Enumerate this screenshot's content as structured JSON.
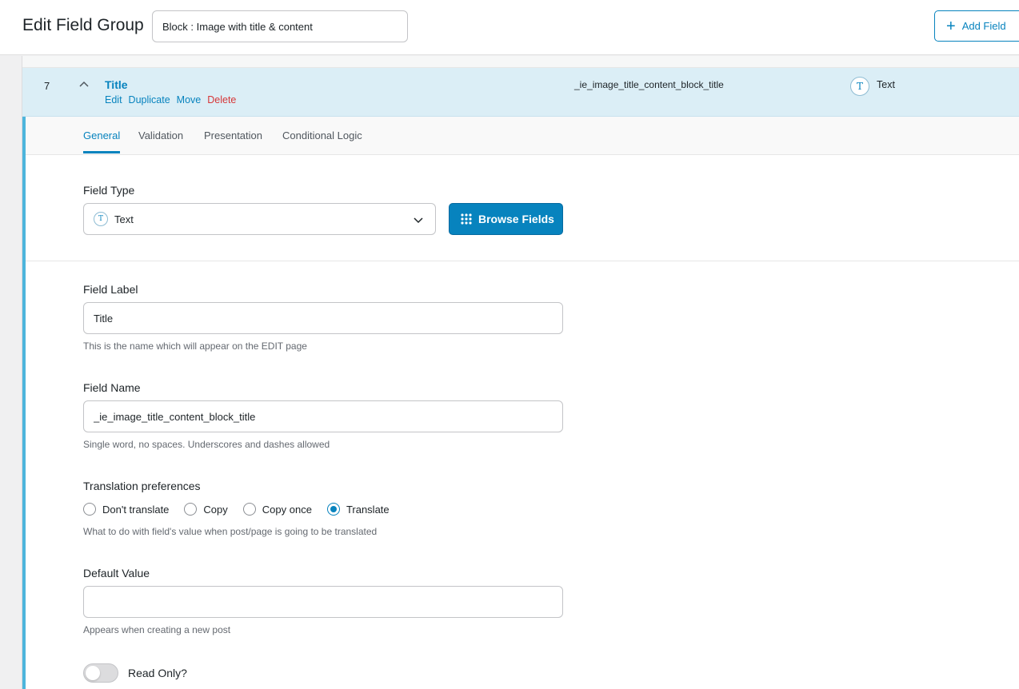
{
  "header": {
    "title": "Edit Field Group",
    "group_title_value": "Block : Image with title & content",
    "add_field_label": "Add Field"
  },
  "field": {
    "order": "7",
    "label": "Title",
    "actions": {
      "edit": "Edit",
      "duplicate": "Duplicate",
      "move": "Move",
      "delete": "Delete"
    },
    "key": "_ie_image_title_content_block_title",
    "type_badge": "T",
    "type": "Text"
  },
  "tabs": [
    "General",
    "Validation",
    "Presentation",
    "Conditional Logic"
  ],
  "active_tab": "General",
  "general": {
    "field_type_label": "Field Type",
    "field_type_icon": "T",
    "field_type_value": "Text",
    "browse_fields_label": "Browse Fields",
    "field_label_label": "Field Label",
    "field_label_value": "Title",
    "field_label_hint": "This is the name which will appear on the EDIT page",
    "field_name_label": "Field Name",
    "field_name_value": "_ie_image_title_content_block_title",
    "field_name_hint": "Single word, no spaces. Underscores and dashes allowed",
    "translation_label": "Translation preferences",
    "translation_options": [
      "Don't translate",
      "Copy",
      "Copy once",
      "Translate"
    ],
    "translation_selected": "Translate",
    "translation_hint": "What to do with field's value when post/page is going to be translated",
    "default_value_label": "Default Value",
    "default_value_value": "",
    "default_value_hint": "Appears when creating a new post",
    "read_only_label": "Read Only?",
    "read_only_on": false
  },
  "colors": {
    "accent": "#0783be",
    "row_highlight": "#dbeef6",
    "delete": "#d63638",
    "settings_border": "#4db5dc"
  }
}
